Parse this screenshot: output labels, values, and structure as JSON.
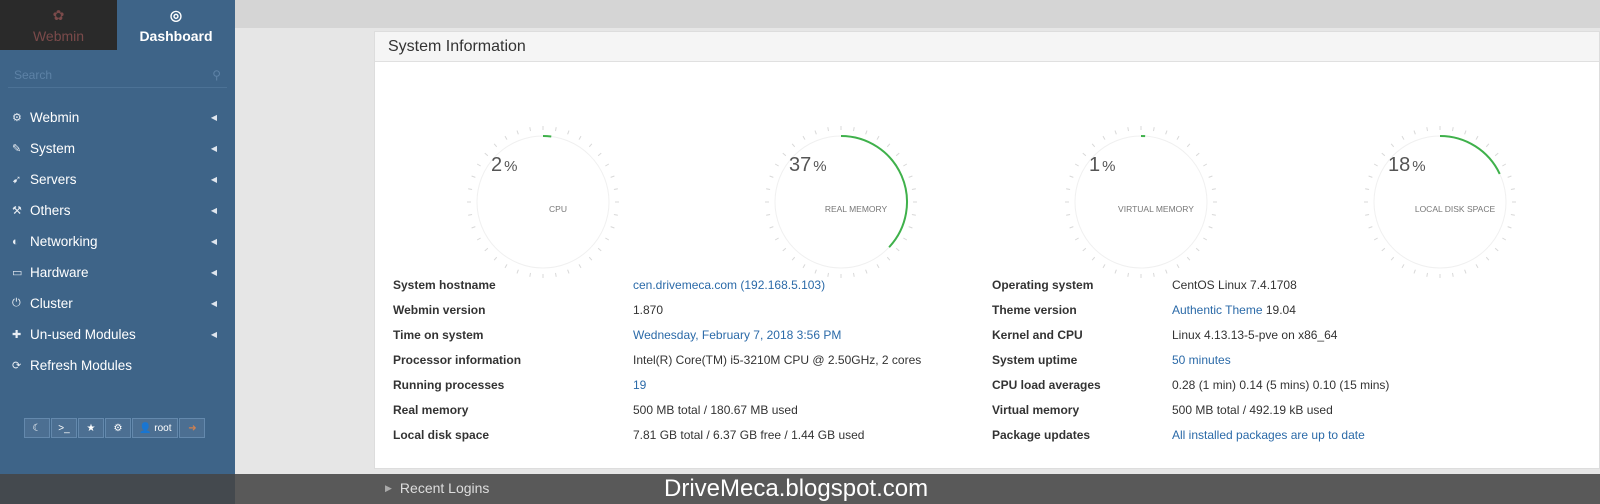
{
  "sidebar": {
    "tabs": [
      {
        "label": "Webmin",
        "icon": "paw-icon"
      },
      {
        "label": "Dashboard",
        "icon": "dashboard-icon"
      }
    ],
    "search_placeholder": "Search",
    "items": [
      {
        "label": "Webmin",
        "icon": "gear-icon"
      },
      {
        "label": "System",
        "icon": "wrench-icon"
      },
      {
        "label": "Servers",
        "icon": "rocket-icon"
      },
      {
        "label": "Others",
        "icon": "gavel-icon"
      },
      {
        "label": "Networking",
        "icon": "shield-icon"
      },
      {
        "label": "Hardware",
        "icon": "hdd-icon"
      },
      {
        "label": "Cluster",
        "icon": "power-icon"
      },
      {
        "label": "Un-used Modules",
        "icon": "puzzle-icon"
      },
      {
        "label": "Refresh Modules",
        "icon": "refresh-icon"
      }
    ],
    "toolbar": {
      "user": "root"
    }
  },
  "panel": {
    "title": "System Information"
  },
  "gauges": [
    {
      "value": 2,
      "label": "CPU"
    },
    {
      "value": 37,
      "label": "REAL MEMORY"
    },
    {
      "value": 1,
      "label": "VIRTUAL MEMORY"
    },
    {
      "value": 18,
      "label": "LOCAL DISK SPACE"
    }
  ],
  "info_left": [
    {
      "label": "System hostname",
      "value": "cen.drivemeca.com (192.168.5.103)",
      "link": true
    },
    {
      "label": "Webmin version",
      "value": "1.870",
      "link": false
    },
    {
      "label": "Time on system",
      "value": "Wednesday, February 7, 2018 3:56 PM",
      "link": true
    },
    {
      "label": "Processor information",
      "value": "Intel(R) Core(TM) i5-3210M CPU @ 2.50GHz, 2 cores",
      "link": false
    },
    {
      "label": "Running processes",
      "value": "19",
      "link": true
    },
    {
      "label": "Real memory",
      "value": "500 MB total / 180.67 MB used",
      "link": false
    },
    {
      "label": "Local disk space",
      "value": "7.81 GB total / 6.37 GB free / 1.44 GB used",
      "link": false
    }
  ],
  "info_right": [
    {
      "label": "Operating system",
      "value": "CentOS Linux 7.4.1708",
      "link": false
    },
    {
      "label": "Theme version",
      "value": "Authentic Theme",
      "extra": "19.04",
      "link": true
    },
    {
      "label": "Kernel and CPU",
      "value": "Linux 4.13.13-5-pve on x86_64",
      "link": false
    },
    {
      "label": "System uptime",
      "value": "50 minutes",
      "link": true
    },
    {
      "label": "CPU load averages",
      "value": "0.28 (1 min) 0.14 (5 mins) 0.10 (15 mins)",
      "link": false
    },
    {
      "label": "Virtual memory",
      "value": "500 MB total / 492.19 kB used",
      "link": false
    },
    {
      "label": "Package updates",
      "value": "All installed packages are up to date",
      "link": true
    }
  ],
  "recent_logins": "Recent Logins",
  "watermark": "DriveMeca.blogspot.com",
  "colors": {
    "sidebar": "#3e6488",
    "gauge_arc": "#3fb14b",
    "link": "#2b6aa8"
  }
}
